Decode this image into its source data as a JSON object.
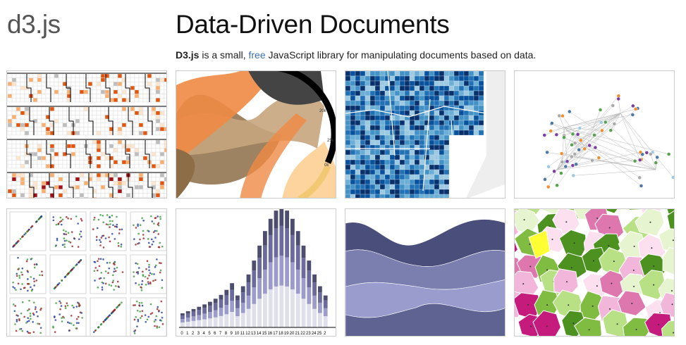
{
  "header": {
    "logo": "d3.js",
    "title": "Data-Driven Documents",
    "tagline_strong": "D3.js",
    "tagline_pre": " is a small, ",
    "tagline_link": "free",
    "tagline_post": " JavaScript library for manipulating documents based on data."
  },
  "gallery": {
    "items": [
      {
        "kind": "calendar-heatmap"
      },
      {
        "kind": "chord-diagram",
        "tick_labels": [
          "20k",
          "25k",
          "0k"
        ]
      },
      {
        "kind": "choropleth-map"
      },
      {
        "kind": "force-graph"
      },
      {
        "kind": "scatterplot-matrix"
      },
      {
        "kind": "stacked-bar-chart",
        "x_labels": [
          "0",
          "1",
          "2",
          "3",
          "4",
          "5",
          "6",
          "7",
          "8",
          "9",
          "10",
          "11",
          "12",
          "13",
          "14",
          "15",
          "16",
          "17",
          "18",
          "19",
          "20",
          "21",
          "22",
          "23",
          "24",
          "25",
          "2"
        ]
      },
      {
        "kind": "streamgraph"
      },
      {
        "kind": "voronoi-diagram"
      }
    ]
  },
  "colors": {
    "link": "#3b6fb4",
    "heat": [
      "#fee6ce",
      "#fdae6b",
      "#e6550d",
      "#a50f15",
      "#bdbdbd",
      "#737373"
    ],
    "chord": [
      "#444444",
      "#8c6d46",
      "#f08a45",
      "#fdd49e",
      "#c7a57d"
    ],
    "map": [
      "#08306b",
      "#08519c",
      "#2171b5",
      "#4292c6",
      "#6baed6",
      "#9ecae1"
    ],
    "scatter": [
      "#1f3d99",
      "#3a9a3a",
      "#9a2222"
    ],
    "bars": [
      "#e0e0ec",
      "#9c9ccc",
      "#6b6b9e",
      "#4d4d70"
    ],
    "stream": [
      "#4a4e7a",
      "#7b7fb0",
      "#9a9ccd",
      "#5e6392"
    ],
    "voronoi": [
      "#c51b7d",
      "#de77ae",
      "#f1b6da",
      "#fde0ef",
      "#e6f5d0",
      "#b8e186",
      "#7fbc41",
      "#4d9221",
      "#ffff33"
    ]
  }
}
